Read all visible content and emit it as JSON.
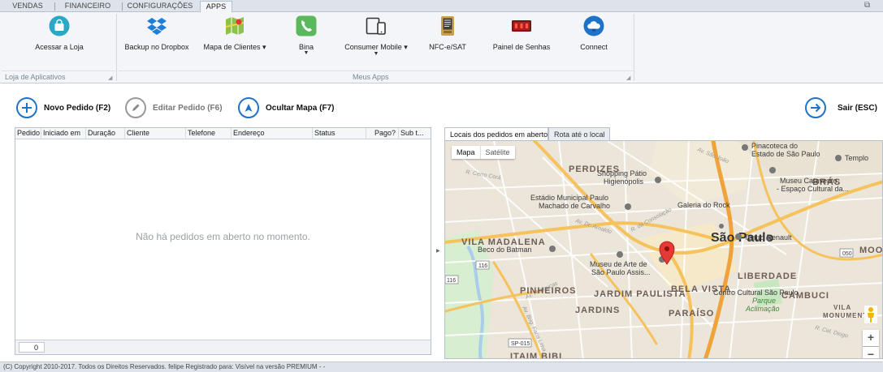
{
  "ribbon": {
    "tabs": [
      {
        "label": "VENDAS"
      },
      {
        "label": "FINANCEIRO"
      },
      {
        "label": "CONFIGURAÇÕES"
      },
      {
        "label": "APPS"
      }
    ],
    "active_tab": "APPS",
    "groups": {
      "store": {
        "label": "Loja de Aplicativos",
        "buttons": [
          {
            "label": "Acessar a Loja",
            "icon": "shopping-bag-icon"
          }
        ]
      },
      "apps": {
        "label": "Meus Apps",
        "buttons": [
          {
            "label": "Backup no Dropbox",
            "icon": "dropbox-icon"
          },
          {
            "label": "Mapa de Clientes ▾",
            "icon": "map-icon"
          },
          {
            "label": "Bina",
            "icon": "phone-icon"
          },
          {
            "label": "Consumer Mobile ▾",
            "icon": "devices-icon"
          },
          {
            "label": "NFC-e/SAT",
            "icon": "receipt-printer-icon"
          },
          {
            "label": "Painel de Senhas",
            "icon": "queue-display-icon"
          },
          {
            "label": "Connect",
            "icon": "cloud-icon"
          }
        ]
      }
    }
  },
  "actions": {
    "new_order": "Novo Pedido (F2)",
    "edit_order": "Editar Pedido (F6)",
    "hide_map": "Ocultar Mapa (F7)",
    "exit": "Sair (ESC)"
  },
  "orders_table": {
    "columns": [
      "Pedido",
      "Iniciado em",
      "Duração",
      "Cliente",
      "Telefone",
      "Endereço",
      "Status",
      "Pago?",
      "Sub t..."
    ],
    "rows": [],
    "empty_message": "Não há pedidos em aberto no momento.",
    "count": "0"
  },
  "map_panel": {
    "tabs": [
      "Locais dos pedidos em aberto",
      "Rota até o local"
    ],
    "active_tab": "Locais dos pedidos em aberto",
    "map_type": [
      "Mapa",
      "Satélite"
    ],
    "labels": {
      "perdizes": "PERDIZES",
      "vila_madalena": "VILA MADALENA",
      "pinheiros": "PINHEIROS",
      "jardins": "JARDINS",
      "bela_vista": "BELA VISTA",
      "liberdade": "LIBERDADE",
      "cambuci": "CAMBUCI",
      "jardim_paulista": "JARDIM PAULISTA",
      "paraiso": "PARAÍSO",
      "bras": "BRÁS",
      "sao_paulo": "São Paulo",
      "itaim_bibi": "ITAIM BIBI",
      "pinacoteca": "Pinacoteca do",
      "estado_sp": "Estado de São Paulo",
      "templo": "Templo",
      "shopping1": "Shopping Pátio",
      "shopping2": "Higienópolis",
      "estadio1": "Estádio Municipal Paulo",
      "estadio2": "Machado de Carvalho",
      "galeria": "Galeria do Rock",
      "museu_cat1": "Museu Catavento",
      "museu_cat2": "- Espaço Cultural da...",
      "teatro": "Teatro Renault",
      "beco": "Beco do Batman",
      "masp1": "Museu de Arte de",
      "masp2": "São Paulo Assis...",
      "ccsp": "Centro Cultural São Paulo",
      "parque1": "Parque",
      "parque2": "Aclimação",
      "vila_mon1": "VILA",
      "vila_mon2": "MONUMENTO",
      "mooca": "MOO",
      "r_cerro_cora": "R. Cerro Corá",
      "av_sao_joao": "Av. São João",
      "av_dr_arnaldo": "Av. Dr. Arnaldo",
      "r_consolacao": "R. da Consolação",
      "av_reboucas": "Av. Rebouças",
      "av_brig_faria_lima": "Av. Brig. Faria Lima",
      "r_cel_diogo": "R. Cel. Diogo",
      "road_116a": "116",
      "road_116b": "116",
      "road_050": "050",
      "road_sp015": "SP-015",
      "zoom_in": "+",
      "zoom_out": "−"
    }
  },
  "status_bar": "(C) Copyright 2010-2017. Todos os Direitos Reservados.   felipe   Registrado para: Visível na versão PREMIUM - -",
  "colors": {
    "accent": "#1e73c8",
    "pin": "#e53935",
    "ribbon_bg": "#f3f5f8"
  }
}
